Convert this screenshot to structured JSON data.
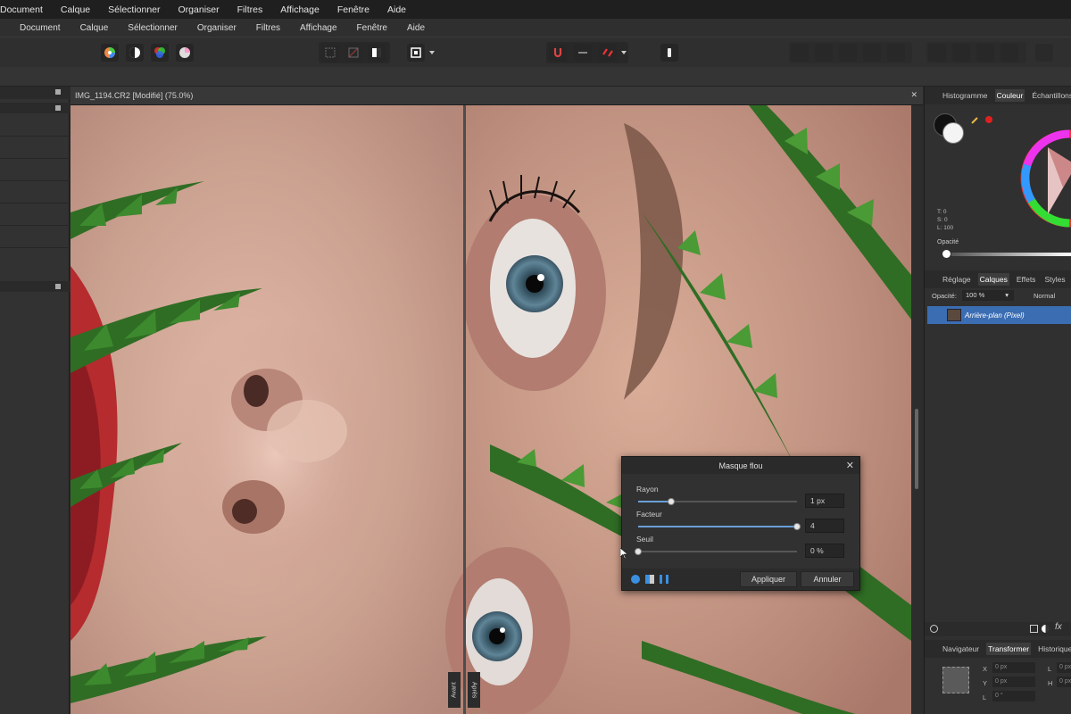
{
  "menu_main": [
    "Document",
    "Calque",
    "Sélectionner",
    "Organiser",
    "Filtres",
    "Affichage",
    "Fenêtre",
    "Aide"
  ],
  "menu_secondary": [
    "Document",
    "Calque",
    "Sélectionner",
    "Organiser",
    "Filtres",
    "Affichage",
    "Fenêtre",
    "Aide"
  ],
  "document": {
    "tab_title": "IMG_1194.CR2 [Modifié] (75.0%)"
  },
  "split_view": {
    "before_label": "Avant",
    "after_label": "Après"
  },
  "right_panel": {
    "top_tabs": [
      "Histogramme",
      "Couleur",
      "Échantillons"
    ],
    "top_active": "Couleur",
    "hsl_readout": [
      "T: 0",
      "S: 0",
      "L: 100"
    ],
    "opacity_label": "Opacité",
    "mid_tabs": [
      "Réglage",
      "Calques",
      "Effets",
      "Styles",
      "St"
    ],
    "mid_active": "Calques",
    "layer_opacity_label": "Opacité:",
    "layer_opacity_value": "100 %",
    "blend_mode": "Normal",
    "layer_name": "Arrière-plan (Pixel)",
    "bottom_tabs": [
      "Navigateur",
      "Transformer",
      "Historique"
    ],
    "bottom_active": "Transformer",
    "transform_labels": [
      "X",
      "Y",
      "L",
      "H",
      "R"
    ],
    "transform_values": [
      "0 px",
      "0 px",
      "0 px",
      "0 px",
      "0 °"
    ]
  },
  "dialog": {
    "title": "Masque flou",
    "sliders": [
      {
        "label": "Rayon",
        "value_text": "1 px",
        "position": 0.21
      },
      {
        "label": "Facteur",
        "value_text": "4",
        "position": 1.0
      },
      {
        "label": "Seuil",
        "value_text": "0 %",
        "position": 0.0
      }
    ],
    "apply_label": "Appliquer",
    "cancel_label": "Annuler"
  },
  "colors": {
    "accent": "#3b6db3",
    "selection_red": "#e02020"
  }
}
